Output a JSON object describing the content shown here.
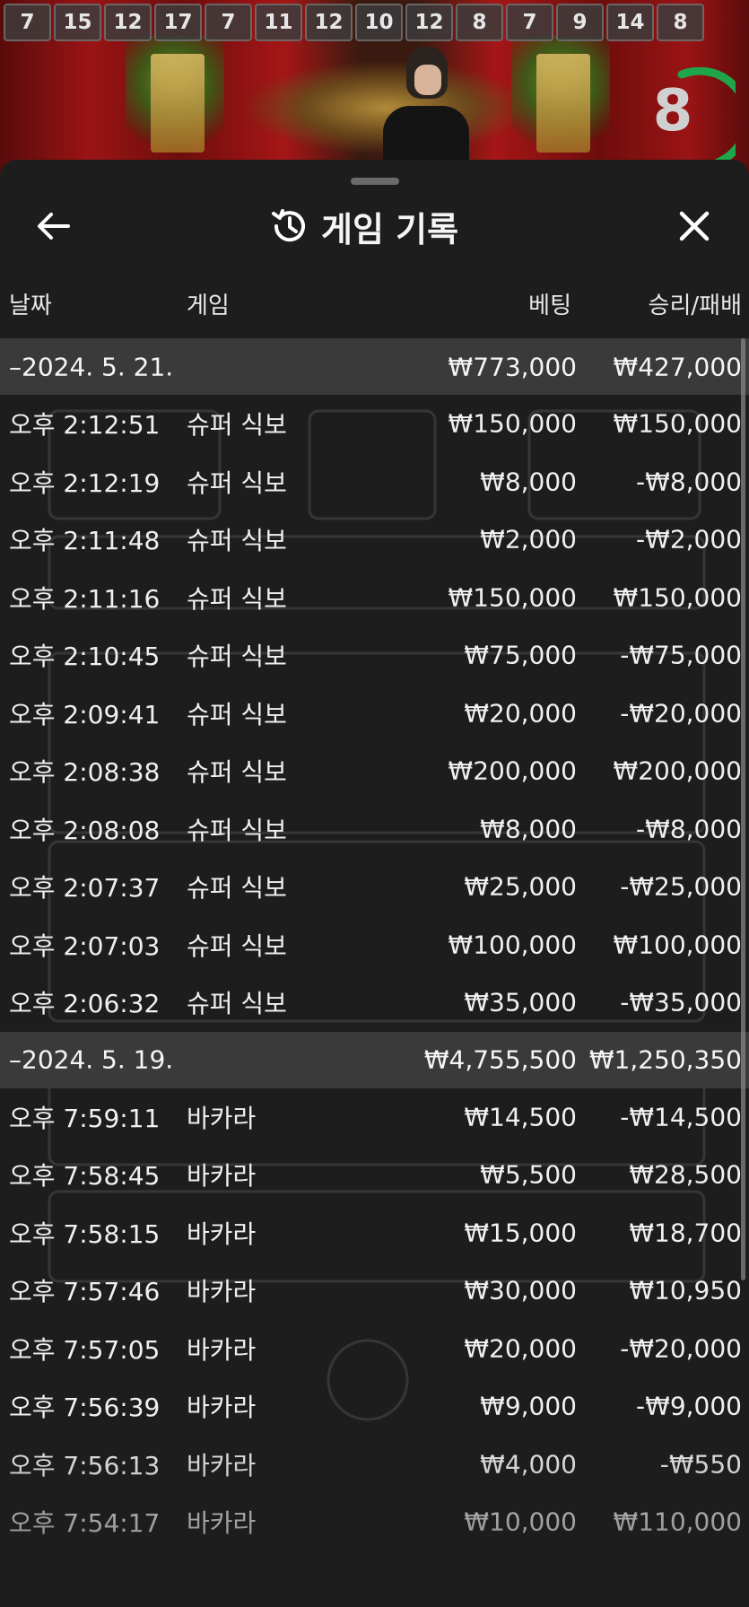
{
  "game_history_strip": [
    "7",
    "15",
    "12",
    "17",
    "7",
    "11",
    "12",
    "10",
    "12",
    "8",
    "7",
    "9",
    "14",
    "8"
  ],
  "countdown": "8",
  "sheet": {
    "title": "게임 기록",
    "icons": {
      "back": "arrow-left-icon",
      "history": "history-icon",
      "close": "close-icon"
    }
  },
  "columns": {
    "date": "날짜",
    "game": "게임",
    "bet": "베팅",
    "win_loss": "승리/패배"
  },
  "groups": [
    {
      "date": "–2024. 5. 21.",
      "bet_total": "₩773,000",
      "wl_total": "₩427,000",
      "rows": [
        {
          "time": "오후 2:12:51",
          "game": "슈퍼 식보",
          "bet": "₩150,000",
          "wl": "₩150,000"
        },
        {
          "time": "오후 2:12:19",
          "game": "슈퍼 식보",
          "bet": "₩8,000",
          "wl": "-₩8,000"
        },
        {
          "time": "오후 2:11:48",
          "game": "슈퍼 식보",
          "bet": "₩2,000",
          "wl": "-₩2,000"
        },
        {
          "time": "오후 2:11:16",
          "game": "슈퍼 식보",
          "bet": "₩150,000",
          "wl": "₩150,000"
        },
        {
          "time": "오후 2:10:45",
          "game": "슈퍼 식보",
          "bet": "₩75,000",
          "wl": "-₩75,000"
        },
        {
          "time": "오후 2:09:41",
          "game": "슈퍼 식보",
          "bet": "₩20,000",
          "wl": "-₩20,000"
        },
        {
          "time": "오후 2:08:38",
          "game": "슈퍼 식보",
          "bet": "₩200,000",
          "wl": "₩200,000"
        },
        {
          "time": "오후 2:08:08",
          "game": "슈퍼 식보",
          "bet": "₩8,000",
          "wl": "-₩8,000"
        },
        {
          "time": "오후 2:07:37",
          "game": "슈퍼 식보",
          "bet": "₩25,000",
          "wl": "-₩25,000"
        },
        {
          "time": "오후 2:07:03",
          "game": "슈퍼 식보",
          "bet": "₩100,000",
          "wl": "₩100,000"
        },
        {
          "time": "오후 2:06:32",
          "game": "슈퍼 식보",
          "bet": "₩35,000",
          "wl": "-₩35,000"
        }
      ]
    },
    {
      "date": "–2024. 5. 19.",
      "bet_total": "₩4,755,500",
      "wl_total": "₩1,250,350",
      "rows": [
        {
          "time": "오후 7:59:11",
          "game": "바카라",
          "bet": "₩14,500",
          "wl": "-₩14,500"
        },
        {
          "time": "오후 7:58:45",
          "game": "바카라",
          "bet": "₩5,500",
          "wl": "₩28,500"
        },
        {
          "time": "오후 7:58:15",
          "game": "바카라",
          "bet": "₩15,000",
          "wl": "₩18,700"
        },
        {
          "time": "오후 7:57:46",
          "game": "바카라",
          "bet": "₩30,000",
          "wl": "₩10,950"
        },
        {
          "time": "오후 7:57:05",
          "game": "바카라",
          "bet": "₩20,000",
          "wl": "-₩20,000"
        },
        {
          "time": "오후 7:56:39",
          "game": "바카라",
          "bet": "₩9,000",
          "wl": "-₩9,000"
        },
        {
          "time": "오후 7:56:13",
          "game": "바카라",
          "bet": "₩4,000",
          "wl": "-₩550"
        },
        {
          "time": "오후 7:54:17",
          "game": "바카라",
          "bet": "₩10,000",
          "wl": "₩110,000"
        }
      ]
    }
  ]
}
